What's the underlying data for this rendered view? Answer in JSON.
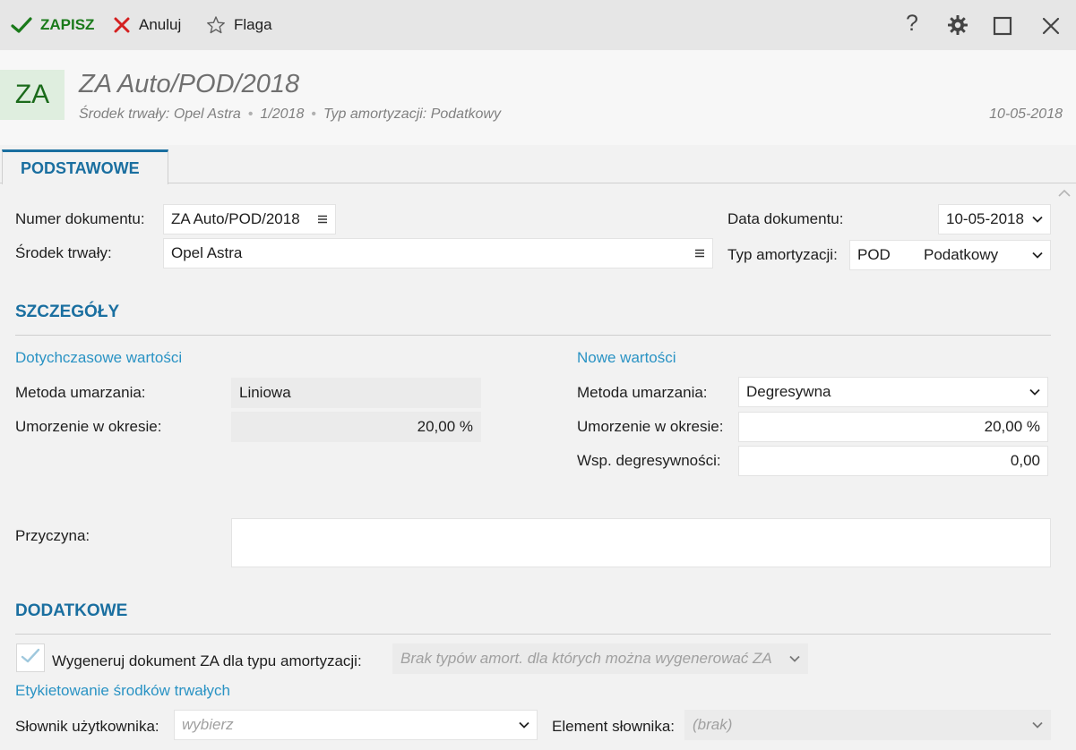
{
  "toolbar": {
    "save_label": "ZAPISZ",
    "cancel_label": "Anuluj",
    "flag_label": "Flaga"
  },
  "header": {
    "badge": "ZA",
    "title": "ZA Auto/POD/2018",
    "meta_asset": "Środek trwały: Opel Astra",
    "meta_number": "1/2018",
    "meta_type": "Typ amortyzacji: Podatkowy",
    "date": "10-05-2018"
  },
  "tabs": [
    {
      "label": "PODSTAWOWE",
      "active": true
    }
  ],
  "form": {
    "doc_number_label": "Numer dokumentu:",
    "doc_number_value": "ZA Auto/POD/2018",
    "asset_label": "Środek trwały:",
    "asset_value": "Opel Astra",
    "doc_date_label": "Data dokumentu:",
    "doc_date_value": "10-05-2018",
    "amort_type_label": "Typ amortyzacji:",
    "amort_type_code": "POD",
    "amort_type_name": "Podatkowy"
  },
  "details": {
    "section_title": "SZCZEGÓŁY",
    "old_values_title": "Dotychczasowe wartości",
    "new_values_title": "Nowe wartości",
    "old_method_label": "Metoda umarzania:",
    "old_method_value": "Liniowa",
    "old_rate_label": "Umorzenie w okresie:",
    "old_rate_value": "20,00 %",
    "new_method_label": "Metoda umarzania:",
    "new_method_value": "Degresywna",
    "new_rate_label": "Umorzenie w okresie:",
    "new_rate_value": "20,00 %",
    "coef_label": "Wsp. degresywności:",
    "coef_value": "0,00",
    "reason_label": "Przyczyna:",
    "reason_value": ""
  },
  "additional": {
    "section_title": "DODATKOWE",
    "generate_label": "Wygeneruj dokument ZA dla typu amortyzacji:",
    "generate_checked": true,
    "generate_select_placeholder": "Brak typów amort. dla których można wygenerować ZA",
    "labeling_title": "Etykietowanie środków trwałych",
    "dict_label": "Słownik użytkownika:",
    "dict_placeholder": "wybierz",
    "element_label": "Element słownika:",
    "element_placeholder": "(brak)"
  },
  "colors": {
    "accent": "#1a6fa0",
    "subheading": "#2a93c4",
    "save_green": "#1a7a1a",
    "cancel_red": "#d42020"
  }
}
